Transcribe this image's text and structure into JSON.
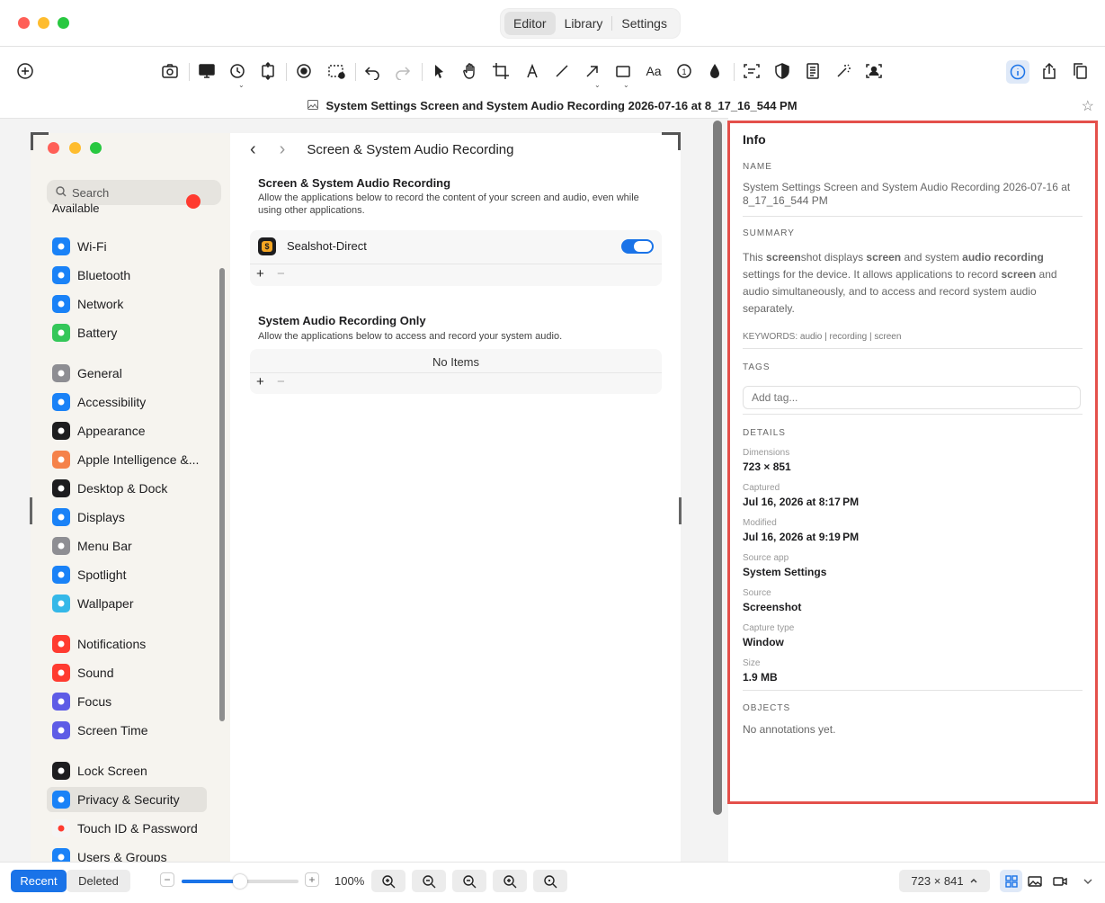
{
  "window": {
    "tabs": [
      {
        "label": "Editor"
      },
      {
        "label": "Library"
      },
      {
        "label": "Settings"
      }
    ],
    "file_title": "System Settings Screen and System Audio Recording 2026-07-16 at 8_17_16_544 PM"
  },
  "toolbar": {
    "text_tool_label": "Aa",
    "counter_tool_label": "1"
  },
  "screenshot": {
    "search_placeholder": "Search",
    "available_label": "Available",
    "sidebar_items": [
      {
        "label": "Wi-Fi",
        "icon": "wifi-icon",
        "color": "#1a82f7"
      },
      {
        "label": "Bluetooth",
        "icon": "bluetooth-icon",
        "color": "#1a82f7"
      },
      {
        "label": "Network",
        "icon": "globe-icon",
        "color": "#1a82f7"
      },
      {
        "label": "Battery",
        "icon": "battery-icon",
        "color": "#34c759"
      },
      {
        "label": "General",
        "icon": "gear-icon",
        "color": "#8e8e93"
      },
      {
        "label": "Accessibility",
        "icon": "accessibility-icon",
        "color": "#1a82f7"
      },
      {
        "label": "Appearance",
        "icon": "appearance-icon",
        "color": "#1d1d1f"
      },
      {
        "label": "Apple Intelligence &...",
        "icon": "apple-intelligence-icon",
        "color": "#f5824a"
      },
      {
        "label": "Desktop & Dock",
        "icon": "dock-icon",
        "color": "#1d1d1f"
      },
      {
        "label": "Displays",
        "icon": "sun-icon",
        "color": "#1a82f7"
      },
      {
        "label": "Menu Bar",
        "icon": "menu-bar-icon",
        "color": "#8e8e93"
      },
      {
        "label": "Spotlight",
        "icon": "spotlight-icon",
        "color": "#1a82f7"
      },
      {
        "label": "Wallpaper",
        "icon": "wallpaper-icon",
        "color": "#35b8e8"
      },
      {
        "label": "Notifications",
        "icon": "bell-icon",
        "color": "#ff3b30"
      },
      {
        "label": "Sound",
        "icon": "speaker-icon",
        "color": "#ff3b30"
      },
      {
        "label": "Focus",
        "icon": "moon-icon",
        "color": "#5e5ce6"
      },
      {
        "label": "Screen Time",
        "icon": "hourglass-icon",
        "color": "#5e5ce6"
      },
      {
        "label": "Lock Screen",
        "icon": "lock-icon",
        "color": "#1d1d1f"
      },
      {
        "label": "Privacy & Security",
        "icon": "hand-icon",
        "color": "#1a82f7"
      },
      {
        "label": "Touch ID & Password",
        "icon": "fingerprint-icon",
        "color": "#f5f5f5"
      },
      {
        "label": "Users & Groups",
        "icon": "users-icon",
        "color": "#1a82f7"
      }
    ],
    "content_title": "Screen & System Audio Recording",
    "section1": {
      "heading": "Screen & System Audio Recording",
      "description": "Allow the applications below to record the content of your screen and audio, even while using other applications.",
      "app_name": "Sealshot-Direct",
      "toggle_on": true
    },
    "section2": {
      "heading": "System Audio Recording Only",
      "description": "Allow the applications below to access and record your system audio.",
      "empty_text": "No Items"
    },
    "plus": "+",
    "minus": "−"
  },
  "info": {
    "title": "Info",
    "name_label": "NAME",
    "name_value": "System Settings Screen and System Audio Recording 2026-07-16 at 8_17_16_544 PM",
    "summary_label": "SUMMARY",
    "summary_parts": [
      {
        "text": "This ",
        "bold": false
      },
      {
        "text": "screen",
        "bold": true
      },
      {
        "text": "shot displays ",
        "bold": false
      },
      {
        "text": "screen",
        "bold": true
      },
      {
        "text": " and system ",
        "bold": false
      },
      {
        "text": "audio recording",
        "bold": true
      },
      {
        "text": " settings for the device. It allows applications to record ",
        "bold": false
      },
      {
        "text": "screen",
        "bold": true
      },
      {
        "text": " and audio simultaneously, and to access and record system audio separately.",
        "bold": false
      }
    ],
    "keywords": "KEYWORDS: audio | recording | screen",
    "tags_label": "TAGS",
    "tag_placeholder": "Add tag...",
    "details_label": "DETAILS",
    "details": [
      {
        "key": "Dimensions",
        "value": "723 × 851"
      },
      {
        "key": "Captured",
        "value": "Jul 16, 2026 at 8:17 PM"
      },
      {
        "key": "Modified",
        "value": "Jul 16, 2026 at 9:19 PM"
      },
      {
        "key": "Source app",
        "value": "System Settings"
      },
      {
        "key": "Source",
        "value": "Screenshot"
      },
      {
        "key": "Capture type",
        "value": "Window"
      },
      {
        "key": "Size",
        "value": "1.9 MB"
      }
    ],
    "objects_label": "OBJECTS",
    "objects_empty": "No annotations yet."
  },
  "bottom": {
    "recent_label": "Recent",
    "deleted_label": "Deleted",
    "zoom_minus": "−",
    "zoom_plus": "+",
    "zoom_fraction": 0.5,
    "zoom_percent": "100%",
    "dimensions": "723 × 841"
  },
  "colors": {
    "accent": "#1a73e8",
    "highlight_border": "#e4504b"
  }
}
